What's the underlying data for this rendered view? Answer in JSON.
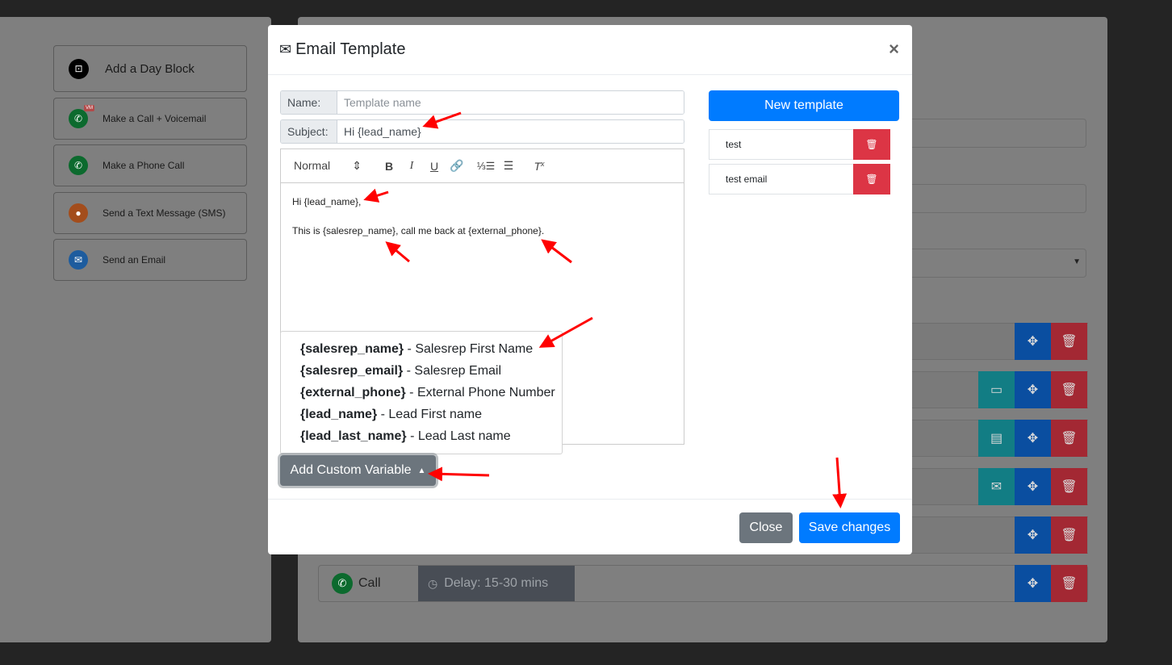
{
  "background": {
    "sidebar_blocks": [
      {
        "label": "Add a Day Block",
        "icon": "calendar-add-icon",
        "color": "#000000"
      },
      {
        "label": "Make a Call + Voicemail",
        "icon": "phone-voicemail-icon",
        "color": "#0c6a2e",
        "badge": "VM"
      },
      {
        "label": "Make a Phone Call",
        "icon": "phone-icon",
        "color": "#0c6a2e"
      },
      {
        "label": "Send a Text Message (SMS)",
        "icon": "sms-icon",
        "color": "#a34d1c"
      },
      {
        "label": "Send an Email",
        "icon": "email-icon",
        "color": "#1d5c9e"
      }
    ],
    "bottom_row": {
      "call_label": "Call",
      "delay_label": "Delay: 15-30 mins"
    }
  },
  "modal": {
    "title": "Email Template",
    "title_icon": "envelope-icon",
    "close_glyph": "×",
    "name_label": "Name:",
    "name_placeholder": "Template name",
    "subject_label": "Subject:",
    "subject_value": "Hi {lead_name}",
    "toolbar": {
      "format_select": "Normal",
      "buttons": [
        "bold",
        "italic",
        "underline",
        "link",
        "ordered-list",
        "bullet-list",
        "clear-format"
      ]
    },
    "editor_lines": [
      "Hi {lead_name},",
      "This is {salesrep_name}, call me back at {external_phone}."
    ],
    "variables": [
      {
        "token": "{salesrep_name}",
        "desc": " - Salesrep First Name"
      },
      {
        "token": "{salesrep_email}",
        "desc": " - Salesrep Email"
      },
      {
        "token": "{external_phone}",
        "desc": " - External Phone Number"
      },
      {
        "token": "{lead_name}",
        "desc": " - Lead First name"
      },
      {
        "token": "{lead_last_name}",
        "desc": " - Lead Last name"
      }
    ],
    "add_variable_label": "Add Custom Variable",
    "new_template_label": "New template",
    "templates": [
      {
        "name": "test"
      },
      {
        "name": "test email"
      }
    ],
    "close_label": "Close",
    "save_label": "Save changes"
  },
  "colors": {
    "primary": "#007bff",
    "secondary": "#6c757d",
    "danger": "#dc3545",
    "annotation_arrow": "#ff0000"
  }
}
